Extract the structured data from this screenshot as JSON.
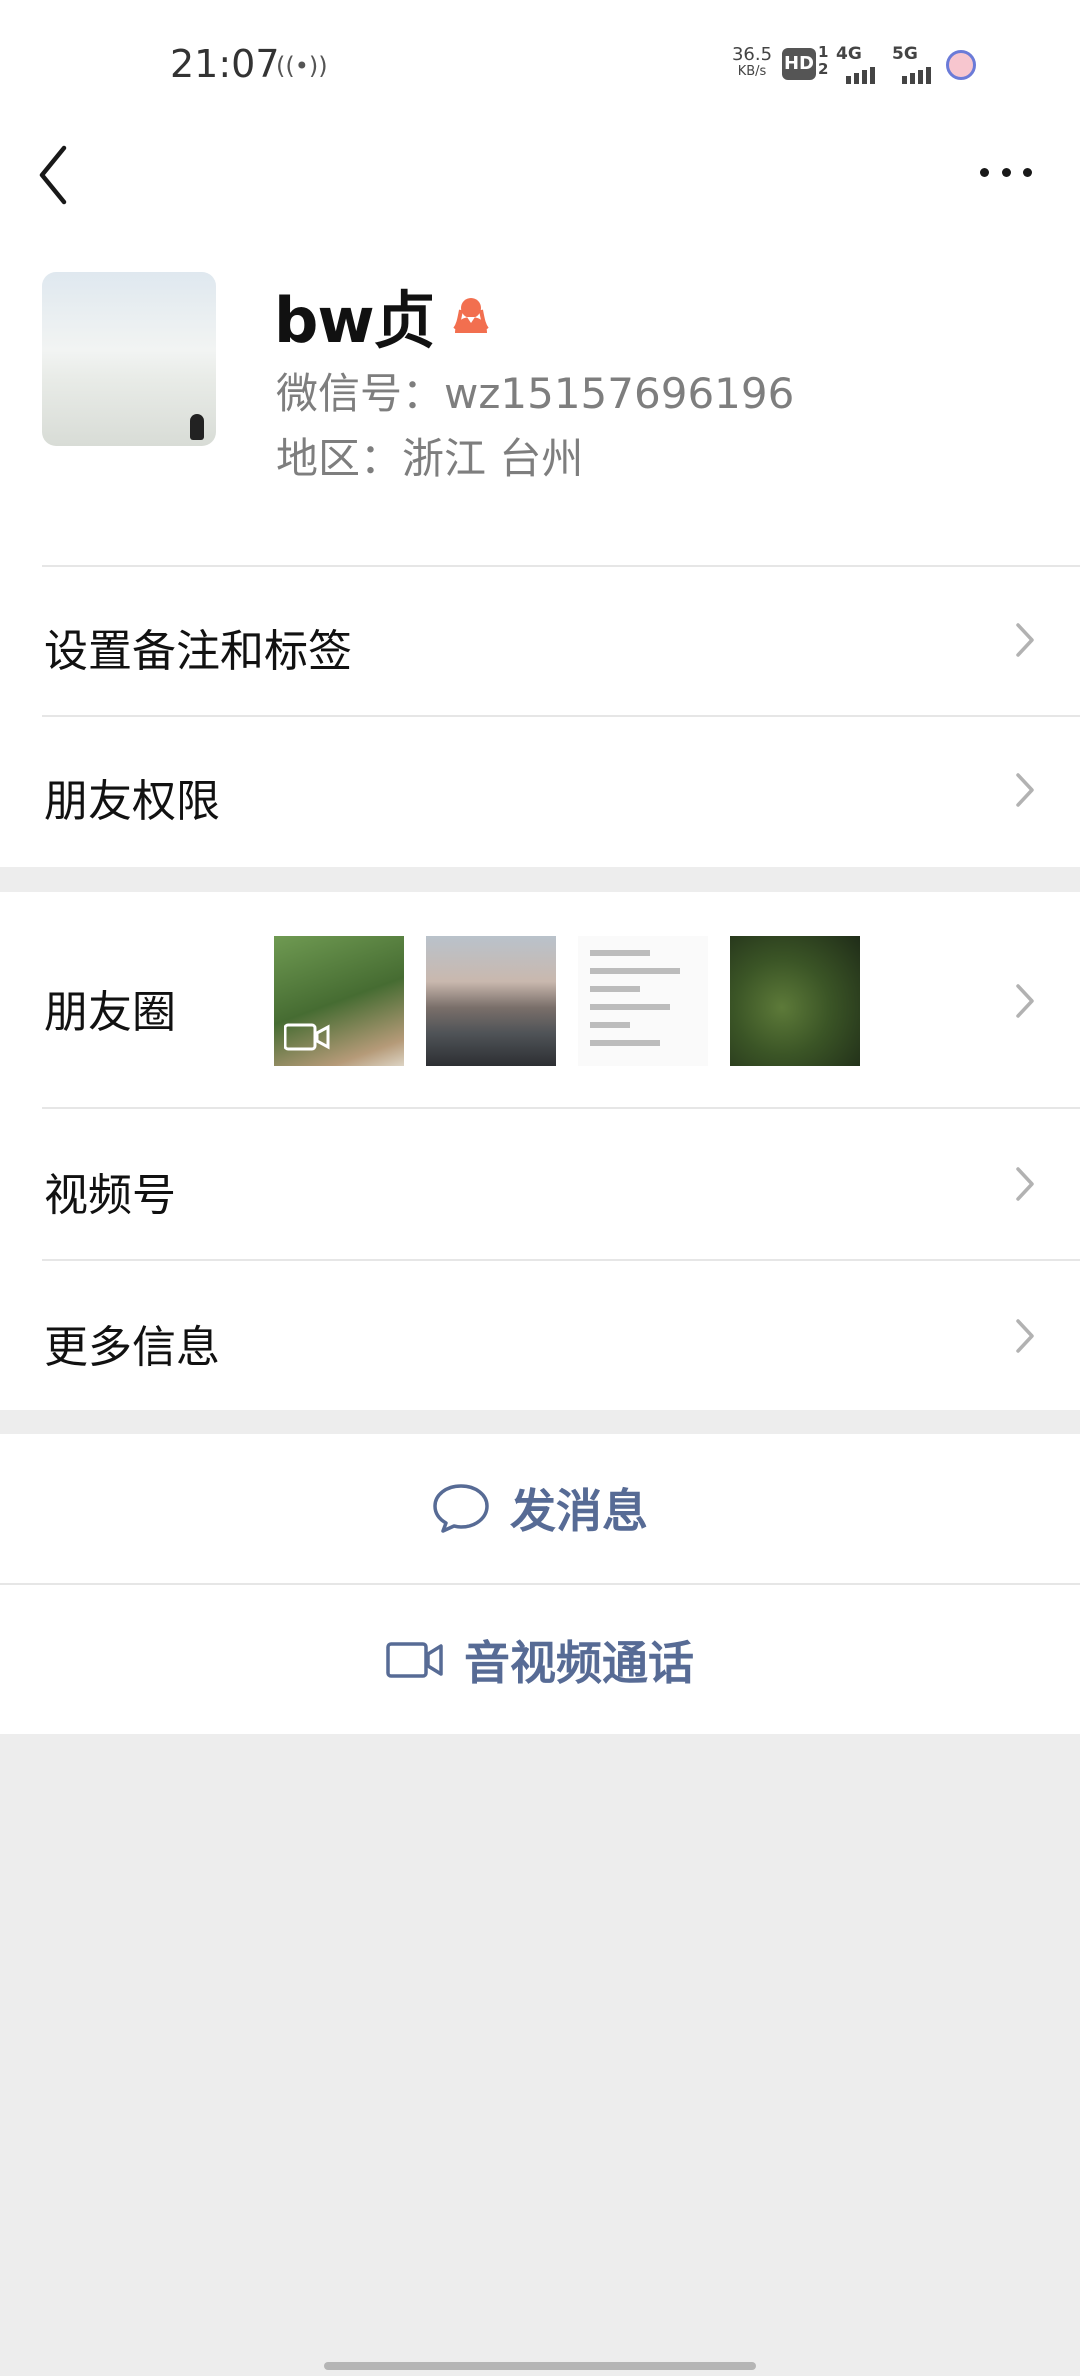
{
  "status_bar": {
    "time": "21:07",
    "net_speed_value": "36.5",
    "net_speed_unit": "KB/s",
    "hd_label": "HD",
    "hd_sub": "1\n2",
    "sim1_label": "4G",
    "sim2_label": "5G"
  },
  "profile": {
    "name": "bw贞",
    "wechat_id": "微信号：wz15157696196",
    "region": "地区：浙江  台州"
  },
  "menu_group_1": {
    "remark_tags": "设置备注和标签",
    "friend_permissions": "朋友权限"
  },
  "menu_group_2": {
    "moments": "朋友圈",
    "channels": "视频号",
    "more_info": "更多信息"
  },
  "actions": {
    "send_message": "发消息",
    "av_call": "音视频通话"
  },
  "colors": {
    "link_blue": "#576b95",
    "background_gray": "#ededed",
    "gender_icon": "#f26f4f"
  }
}
